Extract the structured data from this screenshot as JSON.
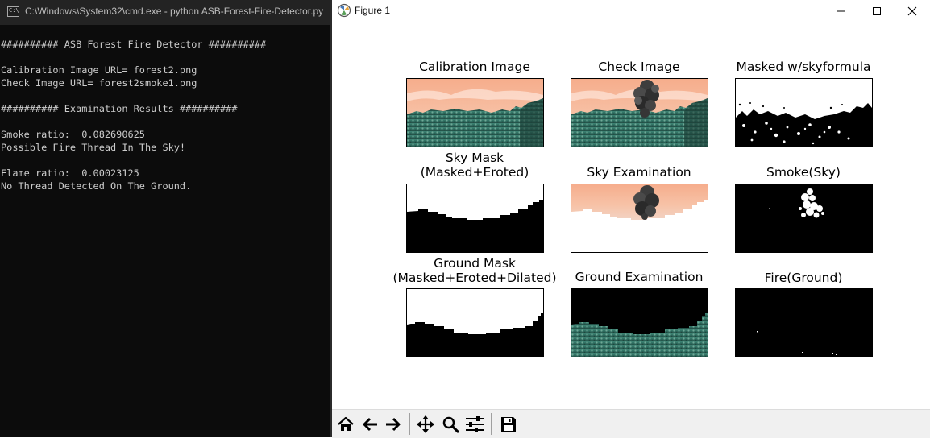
{
  "cmd": {
    "title": "C:\\Windows\\System32\\cmd.exe - python  ASB-Forest-Fire-Detector.py",
    "lines": [
      "########## ASB Forest Fire Detector ##########",
      "",
      "Calibration Image URL= forest2.png",
      "Check Image URL= forest2smoke1.png",
      "",
      "########## Examination Results ##########",
      "",
      "Smoke ratio:  0.082690625",
      "Possible Fire Thread In The Sky!",
      "",
      "Flame ratio:  0.00023125",
      "No Thread Detected On The Ground."
    ]
  },
  "figure": {
    "title": "Figure 1",
    "window_buttons": [
      "minimize",
      "maximize",
      "close"
    ],
    "subplots": [
      {
        "title": "Calibration Image",
        "content": "forest-photo"
      },
      {
        "title": "Check Image",
        "content": "forest-photo-with-smoke"
      },
      {
        "title": "Masked w/skyformula",
        "content": "sky-formula-mask"
      },
      {
        "title": "Sky Mask\n(Masked+Eroted)",
        "content": "sky-mask"
      },
      {
        "title": "Sky Examination",
        "content": "sky-examination"
      },
      {
        "title": "Smoke(Sky)",
        "content": "smoke-mask"
      },
      {
        "title": "Ground Mask\n(Masked+Eroted+Dilated)",
        "content": "ground-mask"
      },
      {
        "title": "Ground Examination",
        "content": "ground-examination"
      },
      {
        "title": "Fire(Ground)",
        "content": "fire-mask"
      }
    ],
    "toolbar": [
      {
        "name": "home",
        "icon": "home-icon"
      },
      {
        "name": "back",
        "icon": "arrow-left-icon"
      },
      {
        "name": "forward",
        "icon": "arrow-right-icon"
      },
      {
        "name": "pan",
        "icon": "move-icon"
      },
      {
        "name": "zoom",
        "icon": "zoom-icon"
      },
      {
        "name": "configure-subplots",
        "icon": "sliders-icon"
      },
      {
        "name": "save",
        "icon": "save-icon"
      }
    ]
  },
  "colors": {
    "console_bg": "#0c0c0c",
    "console_text": "#cccccc",
    "sky": "#f4b093",
    "forest": "#2e6f63",
    "smoke": "#3a3a3a"
  }
}
